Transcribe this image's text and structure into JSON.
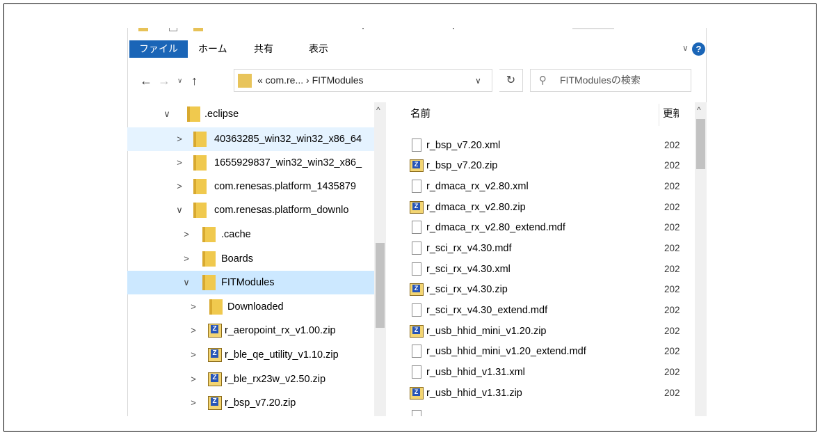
{
  "ribbon": {
    "tabs": [
      {
        "label": "ファイル"
      },
      {
        "label": "ホーム"
      },
      {
        "label": "共有"
      },
      {
        "label": "表示"
      }
    ],
    "expand_glyph": "∨",
    "help_glyph": "?"
  },
  "navigation": {
    "back_glyph": "←",
    "forward_glyph": "→",
    "recent_glyph": "∨",
    "up_glyph": "↑",
    "address_path": "« com.re...  ›  FITModules",
    "address_dropdown_glyph": "∨",
    "refresh_glyph": "↻",
    "search_placeholder": "FITModulesの検索",
    "search_glyph": "⚲"
  },
  "tree": {
    "items": [
      {
        "label": ".eclipse",
        "expand": "∨",
        "type": "folder"
      },
      {
        "label": "40363285_win32_win32_x86_64",
        "expand": ">",
        "type": "folder"
      },
      {
        "label": "1655929837_win32_win32_x86_",
        "expand": ">",
        "type": "folder"
      },
      {
        "label": "com.renesas.platform_1435879",
        "expand": ">",
        "type": "folder"
      },
      {
        "label": "com.renesas.platform_downlo",
        "expand": "∨",
        "type": "folder"
      },
      {
        "label": ".cache",
        "expand": ">",
        "type": "folder"
      },
      {
        "label": "Boards",
        "expand": ">",
        "type": "folder"
      },
      {
        "label": "FITModules",
        "expand": "∨",
        "type": "folder",
        "selected": true
      },
      {
        "label": "Downloaded",
        "expand": ">",
        "type": "folder"
      },
      {
        "label": "r_aeropoint_rx_v1.00.zip",
        "expand": ">",
        "type": "zip"
      },
      {
        "label": "r_ble_qe_utility_v1.10.zip",
        "expand": ">",
        "type": "zip"
      },
      {
        "label": "r_ble_rx23w_v2.50.zip",
        "expand": ">",
        "type": "zip"
      },
      {
        "label": "r_bsp_v7.20.zip",
        "expand": ">",
        "type": "zip"
      }
    ],
    "scroll_up_glyph": "^"
  },
  "files": {
    "col_name": "名前",
    "col_modified": "更新",
    "scroll_up_glyph": "^",
    "items": [
      {
        "name": "r_bsp_v7.20.xml",
        "type": "doc",
        "date": "202"
      },
      {
        "name": "r_bsp_v7.20.zip",
        "type": "zip",
        "date": "202"
      },
      {
        "name": "r_dmaca_rx_v2.80.xml",
        "type": "doc",
        "date": "202"
      },
      {
        "name": "r_dmaca_rx_v2.80.zip",
        "type": "zip",
        "date": "202"
      },
      {
        "name": "r_dmaca_rx_v2.80_extend.mdf",
        "type": "doc",
        "date": "202"
      },
      {
        "name": "r_sci_rx_v4.30.mdf",
        "type": "doc",
        "date": "202"
      },
      {
        "name": "r_sci_rx_v4.30.xml",
        "type": "doc",
        "date": "202"
      },
      {
        "name": "r_sci_rx_v4.30.zip",
        "type": "zip",
        "date": "202"
      },
      {
        "name": "r_sci_rx_v4.30_extend.mdf",
        "type": "doc",
        "date": "202"
      },
      {
        "name": "r_usb_hhid_mini_v1.20.zip",
        "type": "zip",
        "date": "202"
      },
      {
        "name": "r_usb_hhid_mini_v1.20_extend.mdf",
        "type": "doc",
        "date": "202"
      },
      {
        "name": "r_usb_hhid_v1.31.xml",
        "type": "doc",
        "date": "202"
      },
      {
        "name": "r_usb_hhid_v1.31.zip",
        "type": "zip",
        "date": "202"
      }
    ]
  }
}
